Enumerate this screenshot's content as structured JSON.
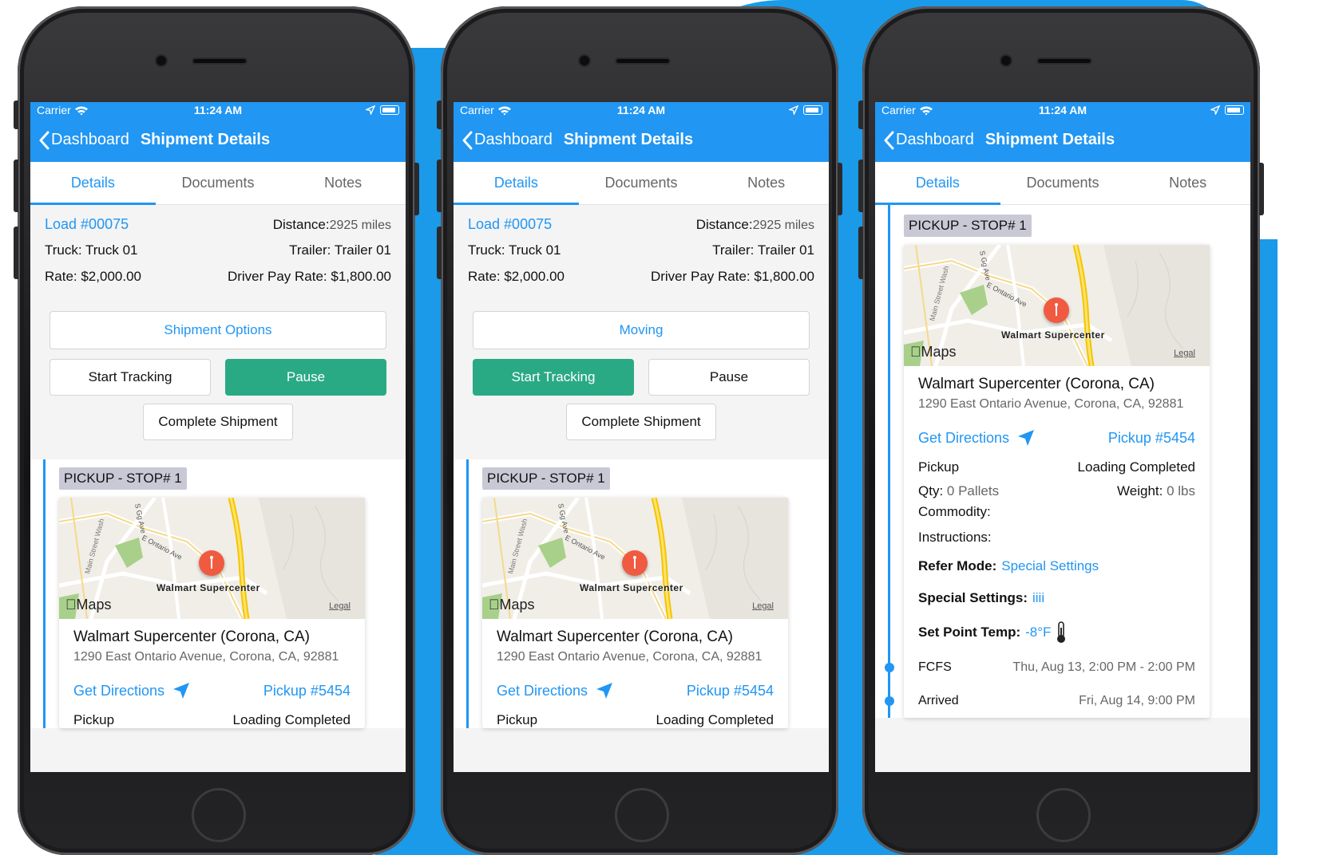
{
  "status": {
    "carrier": "Carrier",
    "time": "11:24 AM"
  },
  "nav": {
    "back_label": "Dashboard",
    "title": "Shipment Details"
  },
  "tabs": [
    "Details",
    "Documents",
    "Notes"
  ],
  "info": {
    "load": "Load #00075",
    "distance_label": "Distance:",
    "distance_value": "2925 miles",
    "truck": "Truck: Truck 01",
    "trailer": "Trailer: Trailer 01",
    "rate": "Rate: $2,000.00",
    "driver_pay": "Driver Pay Rate: $1,800.00"
  },
  "phone1": {
    "option_label": "Shipment Options",
    "start_label": "Start Tracking",
    "pause_label": "Pause",
    "active": "pause"
  },
  "phone2": {
    "option_label": "Moving",
    "start_label": "Start Tracking",
    "pause_label": "Pause",
    "active": "start"
  },
  "complete_label": "Complete Shipment",
  "stop": {
    "tag": "PICKUP - STOP# 1",
    "map_label": "Walmart Supercenter",
    "map_brand": "Maps",
    "map_legal": "Legal",
    "street1": "Main Street Wash",
    "street2": "E Ontario Ave",
    "street3": "S Gg Ave",
    "place": "Walmart Supercenter (Corona, CA)",
    "address": "1290 East Ontario Avenue, Corona, CA, 92881",
    "directions": "Get Directions",
    "pickup_no": "Pickup #5454",
    "type": "Pickup",
    "state": "Loading Completed",
    "qty_label": "Qty:",
    "qty_value": "0 Pallets",
    "weight_label": "Weight:",
    "weight_value": "0 lbs",
    "commodity": "Commodity:",
    "instructions": "Instructions:",
    "refer_label": "Refer Mode:",
    "refer_value": "Special Settings",
    "special_label": "Special Settings:",
    "special_value": "iiii",
    "temp_label": "Set Point Temp:",
    "temp_value": "-8°F",
    "fcfs_label": "FCFS",
    "fcfs_value": "Thu, Aug 13, 2:00 PM - 2:00 PM",
    "arrived_label": "Arrived",
    "arrived_value": "Fri, Aug 14, 9:00 PM"
  },
  "colors": {
    "brand": "#2196f3",
    "active_button": "#2aaa84",
    "background_blob": "#1a9ae8",
    "pin": "#f05a41"
  }
}
